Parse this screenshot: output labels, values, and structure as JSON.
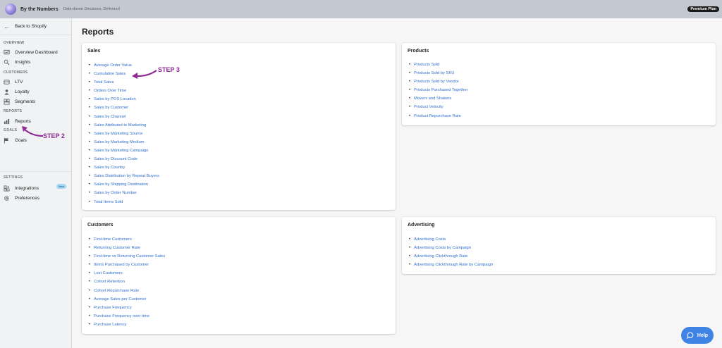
{
  "app": {
    "name": "By the Numbers",
    "tagline": "Data-driven Decisions, Delivered",
    "plan": "Premium Plan"
  },
  "sidebar": {
    "back_label": "Back to Shopify",
    "sections": {
      "overview": "OVERVIEW",
      "customers": "CUSTOMERS",
      "reports": "REPORTS",
      "goals": "GOALS",
      "settings": "SETTINGS"
    },
    "items": {
      "overview_dashboard": "Overview Dashboard",
      "insights": "Insights",
      "ltv": "LTV",
      "loyalty": "Loyalty",
      "segments": "Segments",
      "reports": "Reports",
      "goals": "Goals",
      "integrations": "Integrations",
      "integrations_badge": "New",
      "preferences": "Preferences"
    }
  },
  "page": {
    "title": "Reports"
  },
  "cards": {
    "sales": {
      "title": "Sales",
      "links": [
        "Average Order Value",
        "Cumulative Sales",
        "Total Sales",
        "Orders Over Time",
        "Sales by POS Location",
        "Sales by Customer",
        "Sales by Channel",
        "Sales Attributed to Marketing",
        "Sales by Marketing Source",
        "Sales by Marketing Medium",
        "Sales by Marketing Campaign",
        "Sales by Discount Code",
        "Sales by Country",
        "Sales Distribution by Repeat Buyers",
        "Sales by Shipping Destination",
        "Sales by Order Number",
        "Total Items Sold"
      ]
    },
    "products": {
      "title": "Products",
      "links": [
        "Products Sold",
        "Products Sold by SKU",
        "Products Sold by Vendor",
        "Products Purchased Together",
        "Movers and Shakers",
        "Product Velocity",
        "Product Repurchase Rate"
      ]
    },
    "customers": {
      "title": "Customers",
      "links": [
        "First-time Customers",
        "Returning Customer Rate",
        "First-time vs Returning Customer Sales",
        "Items Purchased by Customer",
        "Lost Customers",
        "Cohort Retention",
        "Cohort Repurchase Rate",
        "Average Sales per Customer",
        "Purchase Frequency",
        "Purchase Frequency over time",
        "Purchase Latency"
      ]
    },
    "advertising": {
      "title": "Advertising",
      "links": [
        "Advertising Costs",
        "Advertising Costs by Campaign",
        "Advertising Clickthrough Rate",
        "Advertising Clickthrough Rate by Campaign"
      ]
    }
  },
  "annotations": {
    "step2": "STEP 2",
    "step3": "STEP 3",
    "color": "#8e2a93"
  },
  "help": {
    "label": "Help"
  },
  "colors": {
    "link": "#2c6ecb",
    "help_button": "#3f84e5",
    "topbar": "#c4c9d1"
  }
}
